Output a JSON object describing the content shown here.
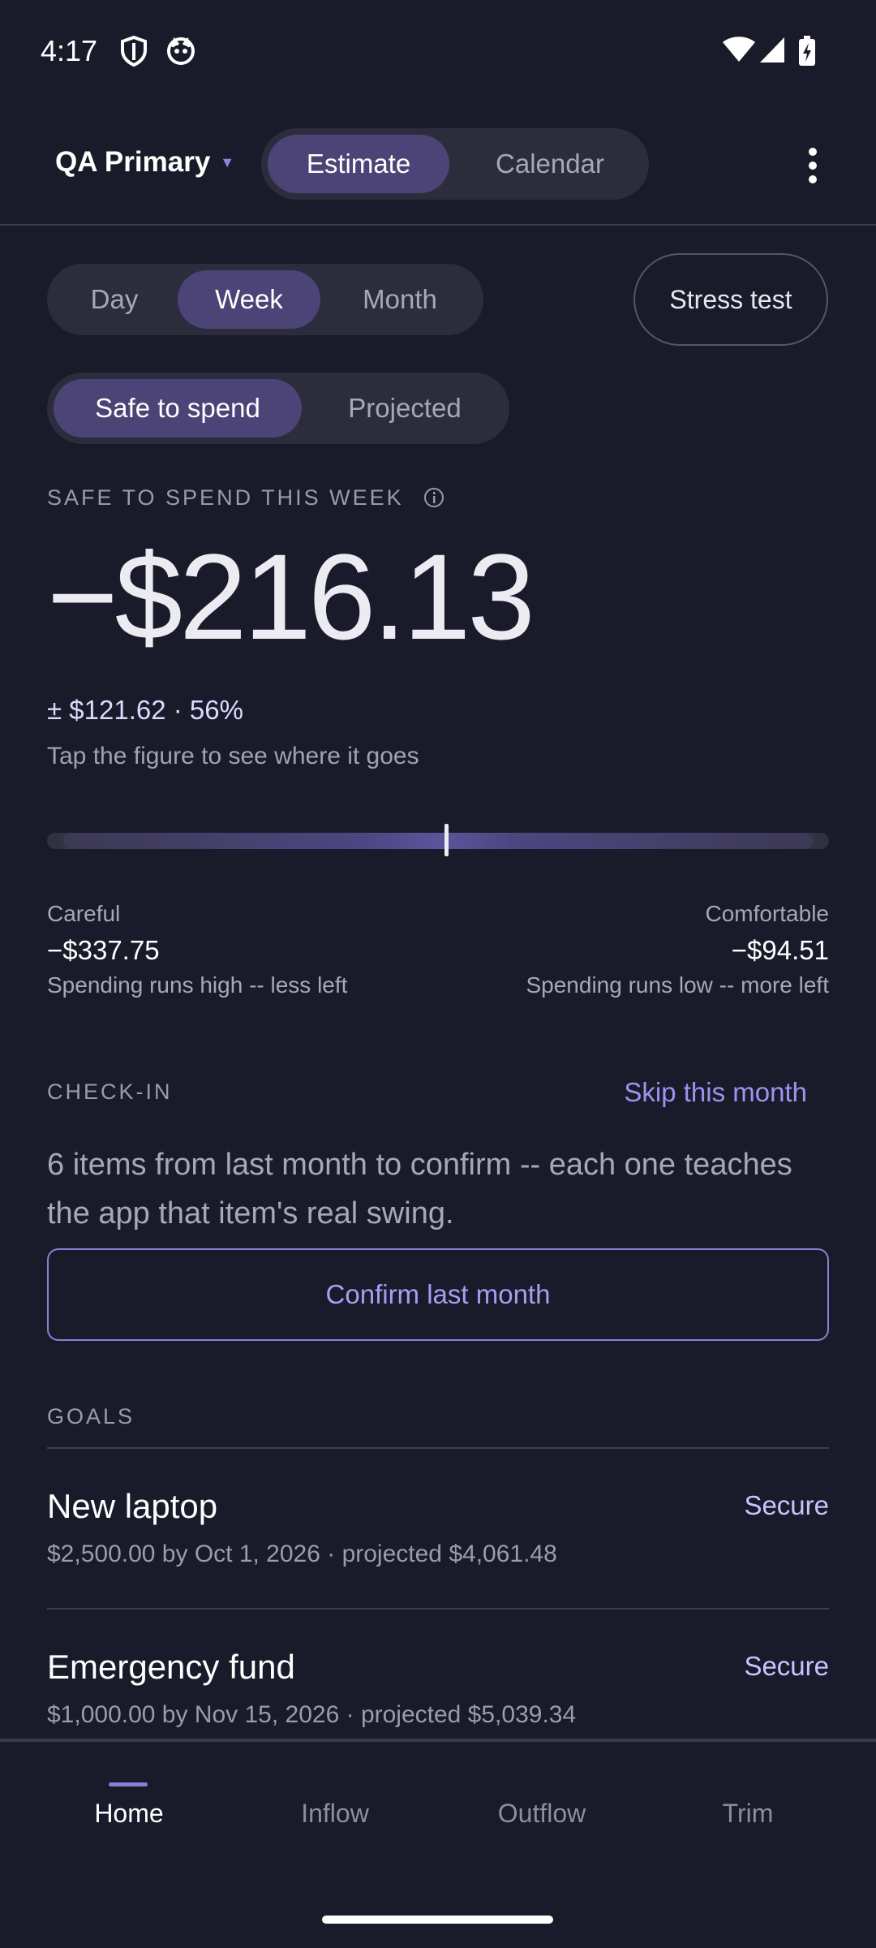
{
  "status_bar": {
    "time": "4:17",
    "left_icons": [
      "shield-icon",
      "cat-face-icon"
    ],
    "right_icons": [
      "wifi-icon",
      "cell-signal-icon",
      "battery-charging-icon"
    ]
  },
  "header": {
    "account": "QA Primary",
    "tabs": [
      {
        "label": "Estimate",
        "active": true
      },
      {
        "label": "Calendar",
        "active": false
      }
    ]
  },
  "period_toggle": [
    {
      "label": "Day",
      "active": false
    },
    {
      "label": "Week",
      "active": true
    },
    {
      "label": "Month",
      "active": false
    }
  ],
  "stress_test_label": "Stress test",
  "mode_toggle": [
    {
      "label": "Safe to spend",
      "active": true
    },
    {
      "label": "Projected",
      "active": false
    }
  ],
  "estimate": {
    "heading": "SAFE TO SPEND THIS WEEK",
    "amount": "−$216.13",
    "range": "± $121.62 · 56%",
    "hint": "Tap the figure to see where it goes",
    "marker_position_fraction": 0.51,
    "careful": {
      "label": "Careful",
      "value": "−$337.75",
      "note": "Spending runs high -- less left"
    },
    "comfortable": {
      "label": "Comfortable",
      "value": "−$94.51",
      "note": "Spending runs low -- more left"
    }
  },
  "checkin": {
    "heading": "CHECK-IN",
    "skip_label": "Skip this month",
    "text": "6 items from last month to confirm -- each one teaches the app that item's real swing.",
    "confirm_label": "Confirm last month"
  },
  "goals": {
    "heading": "GOALS",
    "items": [
      {
        "title": "New laptop",
        "detail": "$2,500.00 by Oct 1, 2026 · projected $4,061.48",
        "action": "Secure"
      },
      {
        "title": "Emergency fund",
        "detail": "$1,000.00 by Nov 15, 2026 · projected $5,039.34",
        "action": "Secure"
      }
    ]
  },
  "bottom_nav": [
    {
      "label": "Home",
      "active": true
    },
    {
      "label": "Inflow",
      "active": false
    },
    {
      "label": "Outflow",
      "active": false
    },
    {
      "label": "Trim",
      "active": false
    }
  ],
  "colors": {
    "background": "#1a1b2a",
    "accent": "#8a7fd6",
    "segment_active": "#4c4476",
    "segment_bg": "#2c2d3c"
  }
}
